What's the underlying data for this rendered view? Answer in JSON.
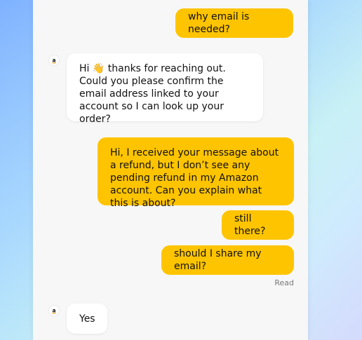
{
  "chat": {
    "messages": [
      {
        "sender": "user",
        "text": "why email is needed?"
      },
      {
        "sender": "agent",
        "text": "Hi 👋 thanks for reaching out. Could you please confirm the email address linked to your account so I can look up your order?"
      },
      {
        "sender": "user",
        "text": "Hi, I received your message about a refund, but I don’t see any pending refund in my Amazon account. Can you explain what this is about?"
      },
      {
        "sender": "user",
        "text": "still there?"
      },
      {
        "sender": "user",
        "text": "should I share my email?"
      },
      {
        "sender": "agent",
        "text": "Yes"
      }
    ],
    "read_status": "Read"
  },
  "colors": {
    "user_bubble": "#ffc400",
    "agent_bubble": "#ffffff",
    "panel_bg": "#f7f7f8"
  },
  "icons": {
    "agent_avatar": "amazon-logo-icon"
  }
}
